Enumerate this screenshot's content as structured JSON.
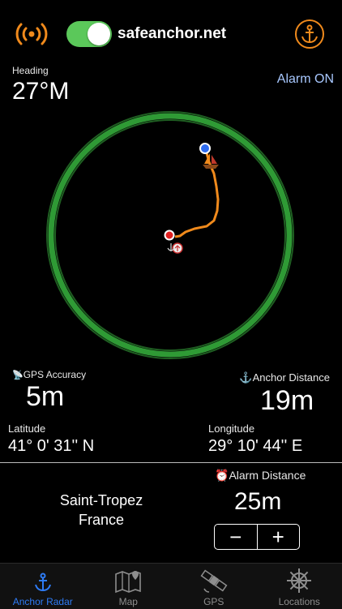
{
  "header": {
    "site": "safeanchor.net",
    "alarm_toggle_on": true
  },
  "heading": {
    "label": "Heading",
    "value": "27°M"
  },
  "alarm_status": "Alarm ON",
  "gps_accuracy": {
    "label": "GPS Accuracy",
    "value": "5m"
  },
  "anchor_distance": {
    "label": "Anchor Distance",
    "value": "19m"
  },
  "latitude": {
    "label": "Latitude",
    "value": "41° 0' 31'' N"
  },
  "longitude": {
    "label": "Longitude",
    "value": "29° 10' 44'' E"
  },
  "location": {
    "city": "Saint-Tropez",
    "country": "France"
  },
  "alarm_distance": {
    "label": "Alarm Distance",
    "value": "25m",
    "minus": "−",
    "plus": "+"
  },
  "tabs": [
    {
      "label": "Anchor Radar",
      "icon": "anchor-icon",
      "active": true
    },
    {
      "label": "Map",
      "icon": "map-icon",
      "active": false
    },
    {
      "label": "GPS",
      "icon": "satellite-icon",
      "active": false
    },
    {
      "label": "Locations",
      "icon": "helm-icon",
      "active": false
    }
  ],
  "colors": {
    "accent": "#f08a1c",
    "toggle": "#5bc85a",
    "radar_ring": "#2f9a35",
    "track": "#f08a1c",
    "tab_active": "#2e7cf6",
    "alarm_text": "#a8c8ff"
  }
}
